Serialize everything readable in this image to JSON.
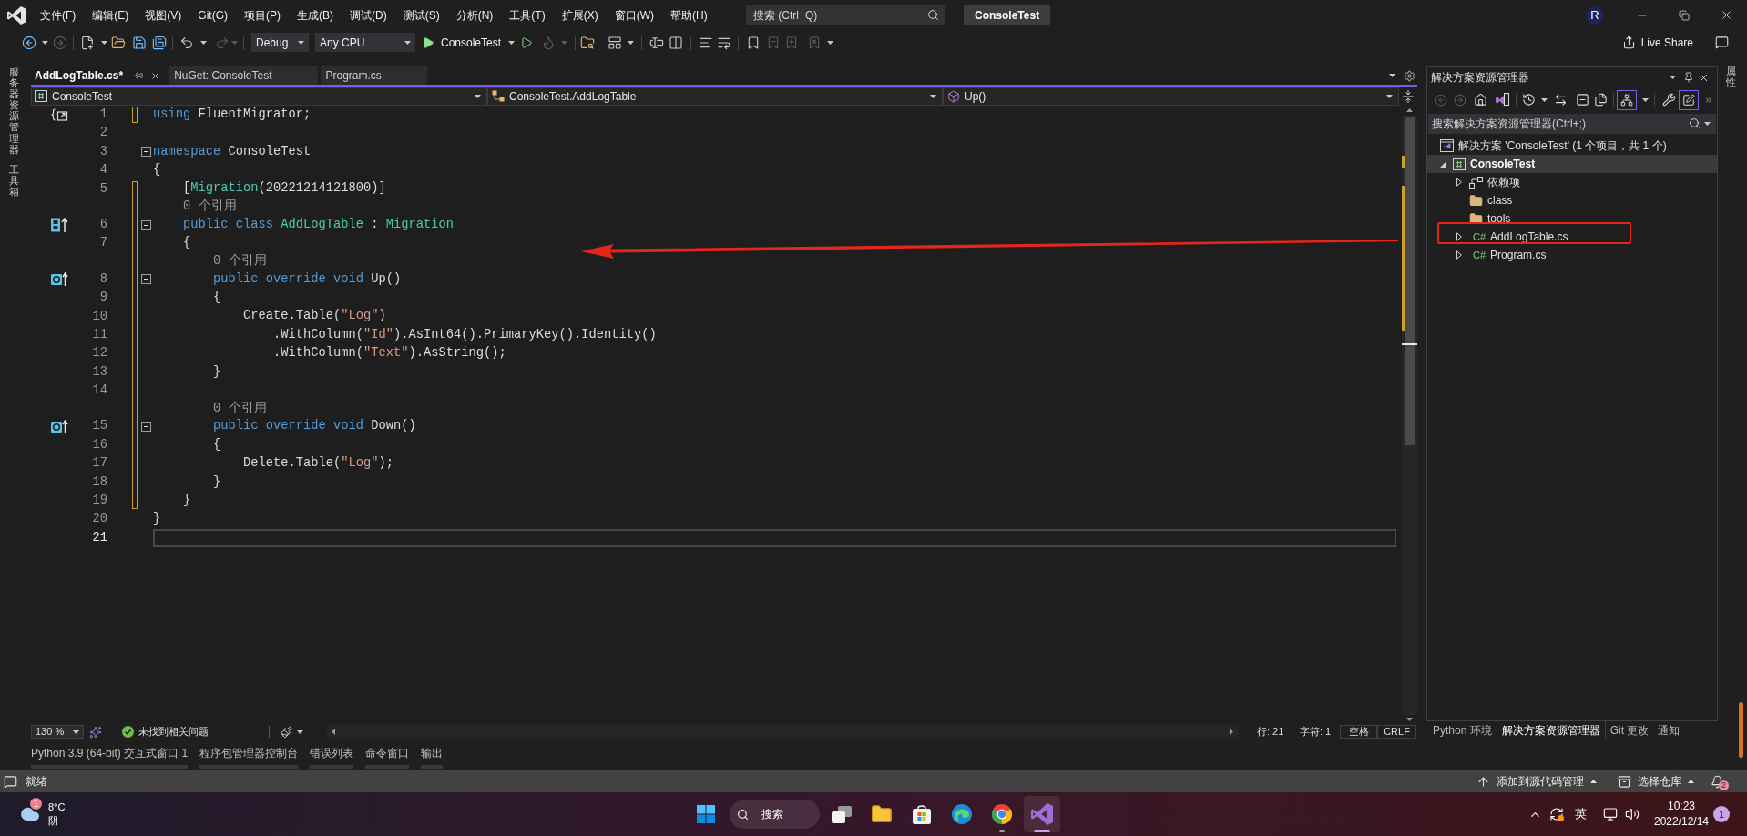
{
  "title_bar": {
    "menu": [
      "文件(F)",
      "编辑(E)",
      "视图(V)",
      "Git(G)",
      "项目(P)",
      "生成(B)",
      "调试(D)",
      "测试(S)",
      "分析(N)",
      "工具(T)",
      "扩展(X)",
      "窗口(W)",
      "帮助(H)"
    ],
    "search": {
      "placeholder": "搜索 (Ctrl+Q)"
    },
    "solution_name": "ConsoleTest",
    "account_initial": "R"
  },
  "toolbar": {
    "configuration": "Debug",
    "platform": "Any CPU",
    "startup_project": "ConsoleTest",
    "live_share": "Live Share"
  },
  "left_dock": {
    "tabs": [
      "服务器资源管理器",
      "工具箱"
    ]
  },
  "document_tabs": [
    {
      "label": "AddLogTable.cs*",
      "selected": true
    },
    {
      "label": "NuGet: ConsoleTest",
      "selected": false
    },
    {
      "label": "Program.cs",
      "selected": false
    }
  ],
  "navigation_bar": {
    "project": "ConsoleTest",
    "type": "ConsoleTest.AddLogTable",
    "member": "Up()"
  },
  "editor": {
    "lines": [
      {
        "number": "1",
        "margin_icon": {
          "kind": "usings"
        },
        "modified": true,
        "current": false,
        "tokens": [
          {
            "kind": "keyword",
            "text": "using"
          },
          {
            "kind": "plain",
            "text": " FluentMigrator;"
          }
        ]
      },
      {
        "number": "2",
        "modified": false,
        "current": false
      },
      {
        "number": "3",
        "fold": {
          "expanded": true
        },
        "modified": false,
        "current": false,
        "tokens": [
          {
            "kind": "keyword",
            "text": "namespace"
          },
          {
            "kind": "plain",
            "text": " ConsoleTest"
          }
        ]
      },
      {
        "number": "4",
        "modified": false,
        "current": false,
        "tokens": [
          {
            "kind": "plain",
            "text": "{"
          }
        ]
      },
      {
        "number": "5",
        "modified": true,
        "current": false,
        "tokens": [
          {
            "kind": "plain",
            "text": "    ["
          },
          {
            "kind": "type",
            "text": "Migration"
          },
          {
            "kind": "plain",
            "text": "(20221214121800)]"
          }
        ]
      },
      {
        "number": "6",
        "codelens": "0 个引用",
        "margin_icon": {
          "kind": "inherits"
        },
        "fold": {
          "expanded": true
        },
        "modified": true,
        "current": false,
        "tokens": [
          {
            "kind": "keyword",
            "text": "    public class "
          },
          {
            "kind": "type",
            "text": "AddLogTable"
          },
          {
            "kind": "plain",
            "text": " : "
          },
          {
            "kind": "type",
            "text": "Migration"
          }
        ]
      },
      {
        "number": "7",
        "modified": true,
        "current": false,
        "tokens": [
          {
            "kind": "plain",
            "text": "    {"
          }
        ]
      },
      {
        "number": "8",
        "codelens": "0 个引用",
        "margin_icon": {
          "kind": "overrides"
        },
        "fold": {
          "expanded": true
        },
        "modified": true,
        "current": false,
        "tokens": [
          {
            "kind": "keyword",
            "text": "        public override void"
          },
          {
            "kind": "plain",
            "text": " Up()"
          }
        ]
      },
      {
        "number": "9",
        "modified": true,
        "current": false,
        "tokens": [
          {
            "kind": "plain",
            "text": "        {"
          }
        ]
      },
      {
        "number": "10",
        "modified": true,
        "current": false,
        "tokens": [
          {
            "kind": "plain",
            "text": "            Create.Table("
          },
          {
            "kind": "string",
            "text": "\"Log\""
          },
          {
            "kind": "plain",
            "text": ")"
          }
        ]
      },
      {
        "number": "11",
        "modified": true,
        "current": false,
        "tokens": [
          {
            "kind": "plain",
            "text": "                .WithColumn("
          },
          {
            "kind": "string",
            "text": "\"Id\""
          },
          {
            "kind": "plain",
            "text": ").AsInt64().PrimaryKey().Identity()"
          }
        ]
      },
      {
        "number": "12",
        "modified": true,
        "current": false,
        "tokens": [
          {
            "kind": "plain",
            "text": "                .WithColumn("
          },
          {
            "kind": "string",
            "text": "\"Text\""
          },
          {
            "kind": "plain",
            "text": ").AsString();"
          }
        ]
      },
      {
        "number": "13",
        "modified": true,
        "current": false,
        "tokens": [
          {
            "kind": "plain",
            "text": "        }"
          }
        ]
      },
      {
        "number": "14",
        "modified": true,
        "current": false
      },
      {
        "number": "15",
        "codelens": "0 个引用",
        "margin_icon": {
          "kind": "overrides"
        },
        "fold": {
          "expanded": true
        },
        "modified": true,
        "current": false,
        "tokens": [
          {
            "kind": "keyword",
            "text": "        public override void"
          },
          {
            "kind": "plain",
            "text": " Down()"
          }
        ]
      },
      {
        "number": "16",
        "modified": true,
        "current": false,
        "tokens": [
          {
            "kind": "plain",
            "text": "        {"
          }
        ]
      },
      {
        "number": "17",
        "modified": true,
        "current": false,
        "tokens": [
          {
            "kind": "plain",
            "text": "            Delete.Table("
          },
          {
            "kind": "string",
            "text": "\"Log\""
          },
          {
            "kind": "plain",
            "text": ");"
          }
        ]
      },
      {
        "number": "18",
        "modified": true,
        "current": false,
        "tokens": [
          {
            "kind": "plain",
            "text": "        }"
          }
        ]
      },
      {
        "number": "19",
        "modified": true,
        "current": false,
        "tokens": [
          {
            "kind": "plain",
            "text": "    }"
          }
        ]
      },
      {
        "number": "20",
        "modified": false,
        "current": false,
        "tokens": [
          {
            "kind": "plain",
            "text": "}"
          }
        ]
      },
      {
        "number": "21",
        "modified": false,
        "current": true
      }
    ]
  },
  "editor_status": {
    "zoom": "130 %",
    "issues": "未找到相关问题",
    "line": "行: 21",
    "column": "字符: 1",
    "indentation": "空格",
    "line_ending": "CRLF"
  },
  "tool_window_tabs": [
    "Python 3.9 (64-bit) 交互式窗口 1",
    "程序包管理器控制台",
    "错误列表",
    "命令窗口",
    "输出"
  ],
  "solution_explorer": {
    "title": "解决方案资源管理器",
    "search": {
      "placeholder": "搜索解决方案资源管理器(Ctrl+;)"
    },
    "tree": [
      {
        "label": "解决方案 'ConsoleTest' (1 个项目，共 1 个)",
        "kind": "solution",
        "selected": false,
        "highlighted": false,
        "children": [
          {
            "label": "ConsoleTest",
            "kind": "project",
            "expanded": true,
            "selected": true,
            "highlighted": false,
            "children": [
              {
                "label": "依赖项",
                "kind": "dependencies",
                "expanded": false,
                "selected": false,
                "highlighted": false
              },
              {
                "label": "class",
                "kind": "folder",
                "selected": false,
                "highlighted": false
              },
              {
                "label": "tools",
                "kind": "folder",
                "selected": false,
                "highlighted": false
              },
              {
                "label": "AddLogTable.cs",
                "kind": "csharp",
                "badge": "C#",
                "expanded": false,
                "selected": false,
                "highlighted": true
              },
              {
                "label": "Program.cs",
                "kind": "csharp",
                "badge": "C#",
                "expanded": false,
                "selected": false,
                "highlighted": false
              }
            ]
          }
        ]
      }
    ],
    "tabs": [
      {
        "label": "Python 环境",
        "selected": false
      },
      {
        "label": "解决方案资源管理器",
        "selected": true
      },
      {
        "label": "Git 更改",
        "selected": false
      },
      {
        "label": "通知",
        "selected": false
      }
    ]
  },
  "right_dock": {
    "tabs": [
      "属性"
    ]
  },
  "status_bar": {
    "message": "就绪",
    "source_control": "添加到源代码管理",
    "repository": "选择仓库",
    "notification_count": "2"
  },
  "taskbar": {
    "weather": {
      "badge": "1",
      "temperature": "8°C",
      "condition": "阴"
    },
    "search_label": "搜索",
    "apps": [
      {
        "kind": "task-view",
        "running": false,
        "selected": false
      },
      {
        "kind": "file-explorer",
        "running": false,
        "selected": false
      },
      {
        "kind": "store",
        "running": false,
        "selected": false
      },
      {
        "kind": "edge",
        "running": false,
        "selected": false
      },
      {
        "kind": "chrome",
        "running": true,
        "selected": false
      },
      {
        "kind": "visual-studio",
        "running": true,
        "selected": true
      }
    ],
    "tray": {
      "input_method": "英",
      "time": "10:23",
      "date": "2022/12/14",
      "notification_count": "1"
    }
  }
}
